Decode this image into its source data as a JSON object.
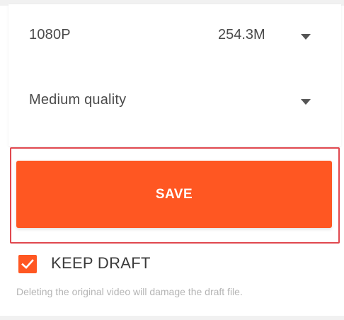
{
  "export": {
    "resolution": {
      "value": "1080P",
      "size": "254.3M",
      "icon": "caret-down-icon"
    },
    "quality": {
      "value": "Medium quality",
      "icon": "caret-down-icon"
    }
  },
  "actions": {
    "save_label": "SAVE"
  },
  "keep_draft": {
    "label": "KEEP DRAFT",
    "checked": true,
    "icon": "checkmark-icon"
  },
  "note": "Deleting the original video will damage the draft file.",
  "colors": {
    "accent": "#ff5722",
    "highlight_border": "#e0484f",
    "text": "#4a4a4a",
    "muted": "#b5b5b5"
  }
}
